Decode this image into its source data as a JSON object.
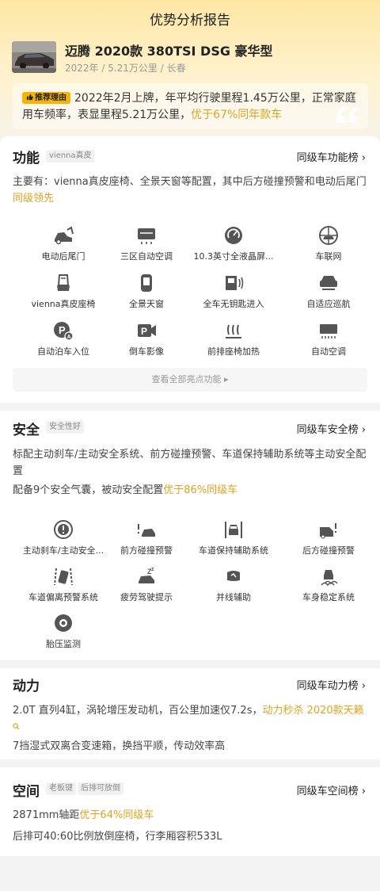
{
  "header": {
    "title": "优势分析报告"
  },
  "car": {
    "name": "迈腾 2020款 380TSI DSG 豪华型",
    "meta": "2022年 / 5.21万公里 / 长春"
  },
  "reason": {
    "badge": "推荐理由",
    "text": "2022年2月上牌，年平均行驶里程1.45万公里，正常家庭用车频率，表显里程5.21万公里，",
    "highlight": "优于67%同年款车"
  },
  "features": {
    "title": "功能",
    "tag": "vienna真皮",
    "rank_link": "同级车功能榜",
    "desc": "主要有：vienna真皮座椅、全景天窗等配置，其中后方碰撞预警和电动后尾门",
    "desc_hl": "同级领先",
    "items": [
      {
        "label": "电动后尾门",
        "icon": "power-tailgate-icon"
      },
      {
        "label": "三区自动空调",
        "icon": "three-zone-ac-icon"
      },
      {
        "label": "10.3英寸全液晶屏...",
        "icon": "lcd-gauge-icon"
      },
      {
        "label": "车联网",
        "icon": "connected-car-icon"
      },
      {
        "label": "vienna真皮座椅",
        "icon": "leather-seat-icon"
      },
      {
        "label": "全景天窗",
        "icon": "panoramic-sunroof-icon"
      },
      {
        "label": "全车无钥匙进入",
        "icon": "keyless-entry-icon"
      },
      {
        "label": "自适应巡航",
        "icon": "adaptive-cruise-icon"
      },
      {
        "label": "自动泊车入位",
        "icon": "auto-parking-icon"
      },
      {
        "label": "倒车影像",
        "icon": "reverse-camera-icon"
      },
      {
        "label": "前排座椅加热",
        "icon": "seat-heating-icon"
      },
      {
        "label": "自动空调",
        "icon": "auto-ac-icon"
      }
    ],
    "more": "查看全部亮点功能 ▸"
  },
  "safety": {
    "title": "安全",
    "tag": "安全性好",
    "rank_link": "同级车安全榜",
    "desc1": "标配主动刹车/主动安全系统、前方碰撞预警、车道保持辅助系统等主动安全配置",
    "desc2": "配备9个安全气囊，被动安全配置",
    "desc2_hl": "优于86%同级车",
    "items": [
      {
        "label": "主动刹车/主动安全...",
        "icon": "active-brake-icon"
      },
      {
        "label": "前方碰撞预警",
        "icon": "front-collision-warning-icon"
      },
      {
        "label": "车道保持辅助系统",
        "icon": "lane-keep-icon"
      },
      {
        "label": "后方碰撞预警",
        "icon": "rear-collision-warning-icon"
      },
      {
        "label": "车道偏离预警系统",
        "icon": "lane-departure-icon"
      },
      {
        "label": "疲劳驾驶提示",
        "icon": "fatigue-alert-icon"
      },
      {
        "label": "并线辅助",
        "icon": "blind-spot-icon"
      },
      {
        "label": "车身稳定系统",
        "icon": "stability-control-icon"
      },
      {
        "label": "胎压监测",
        "icon": "tire-pressure-icon"
      }
    ]
  },
  "power": {
    "title": "动力",
    "rank_link": "同级车动力榜",
    "desc1": "2.0T 直列4缸，涡轮增压发动机，百公里加速仅7.2s，",
    "desc1_hl": "动力秒杀 2020款天籁",
    "desc2": "7挡湿式双离合变速箱，换挡平顺，传动效率高"
  },
  "space": {
    "title": "空间",
    "tag1": "老板键",
    "tag2": "后排可放倒",
    "rank_link": "同级车空间榜",
    "desc1": "2871mm轴距",
    "desc1_hl": "优于64%同级车",
    "desc2": "后排可40:60比例放倒座椅，行李厢容积533L"
  },
  "colors": {
    "accent": "#d9a422",
    "badge": "#f5b400",
    "icon": "#555555"
  }
}
